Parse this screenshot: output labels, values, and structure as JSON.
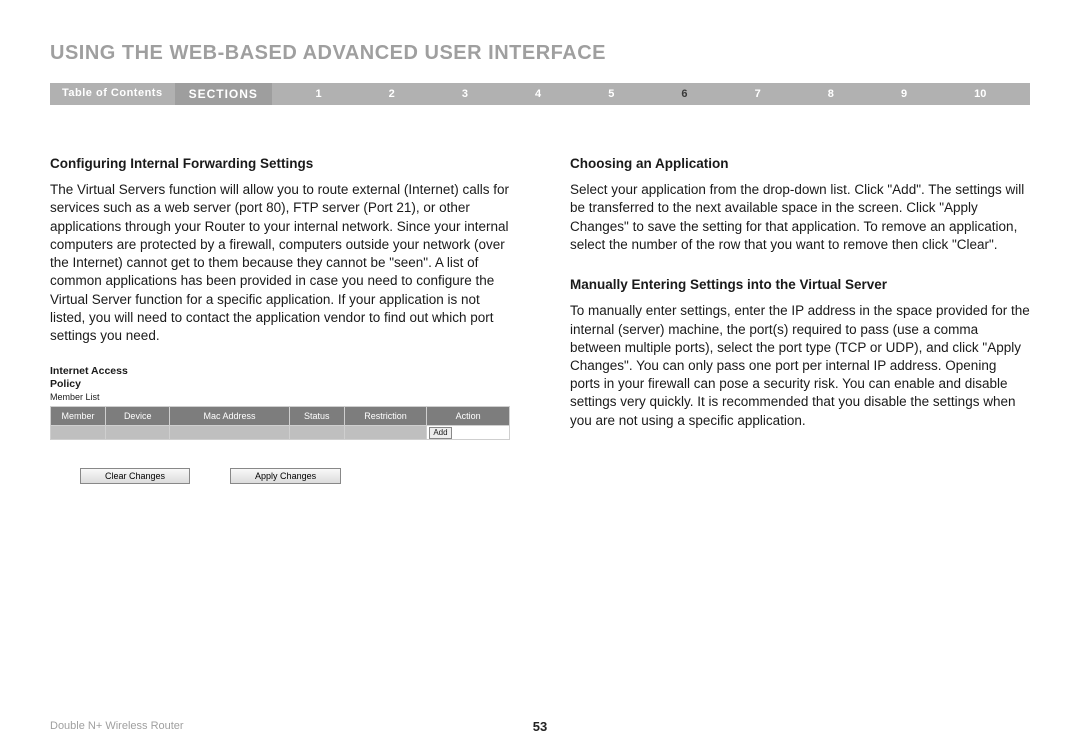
{
  "header": {
    "title": "USING THE WEB-BASED ADVANCED USER INTERFACE"
  },
  "nav": {
    "toc": "Table of Contents",
    "sections_label": "SECTIONS",
    "numbers": [
      "1",
      "2",
      "3",
      "4",
      "5",
      "6",
      "7",
      "8",
      "9",
      "10"
    ],
    "active": "6"
  },
  "left": {
    "heading": "Configuring Internal Forwarding Settings",
    "body": "The Virtual Servers function will allow you to route external (Internet) calls for services such as a web server (port 80), FTP server (Port 21), or other applications through your Router to your internal network. Since your internal computers are protected by a firewall, computers outside your network (over the Internet) cannot get to them because they cannot be \"seen\". A list of common applications has been provided in case you need to configure the Virtual Server function for a specific application. If your application is not listed, you will need to contact the application vendor to find out which port settings you need.",
    "policy": {
      "title_line1": "Internet Access",
      "title_line2": "Policy",
      "subtitle": "Member List",
      "columns": [
        "Member",
        "Device",
        "Mac Address",
        "Status",
        "Restriction",
        "Action"
      ],
      "add_label": "Add",
      "clear_btn": "Clear Changes",
      "apply_btn": "Apply Changes"
    }
  },
  "right": {
    "heading1": "Choosing an Application",
    "body1": "Select your application from the drop-down list. Click \"Add\". The settings will be transferred to the next available space in the screen. Click \"Apply Changes\" to save the setting for that application. To remove an application, select the number of the row that you want to remove then click \"Clear\".",
    "heading2": "Manually Entering Settings into the Virtual Server",
    "body2": "To manually enter settings, enter the IP address in the space provided for the internal (server) machine, the port(s) required to pass (use a comma between multiple ports), select the port type (TCP or UDP), and click \"Apply Changes\". You can only pass one port per internal IP address. Opening ports in your firewall can pose a security risk. You can enable and disable settings very quickly. It is recommended that you disable the settings when you are not using a specific application."
  },
  "footer": {
    "product": "Double N+ Wireless Router",
    "page": "53"
  }
}
